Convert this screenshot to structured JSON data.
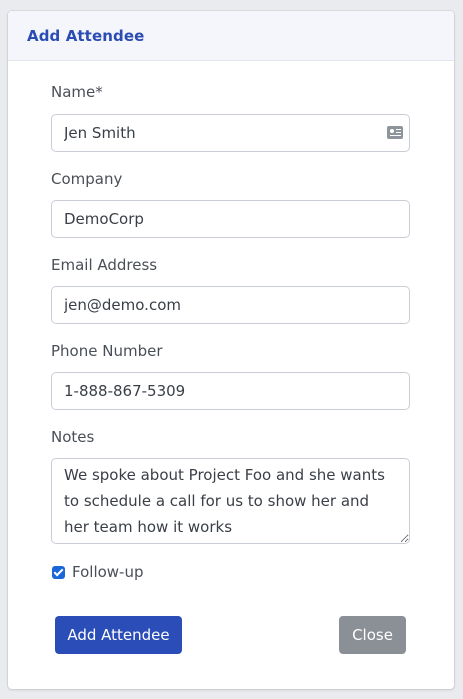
{
  "header": {
    "title": "Add Attendee"
  },
  "form": {
    "name": {
      "label": "Name*",
      "value": "Jen Smith",
      "icon": "contact-card-icon"
    },
    "company": {
      "label": "Company",
      "value": "DemoCorp"
    },
    "email": {
      "label": "Email Address",
      "value": "jen@demo.com"
    },
    "phone": {
      "label": "Phone Number",
      "value": "1-888-867-5309"
    },
    "notes": {
      "label": "Notes",
      "value": "We spoke about Project Foo and she wants to schedule a call for us to show her and her team how it works"
    },
    "followup": {
      "label": "Follow-up",
      "checked": true
    }
  },
  "actions": {
    "submit_label": "Add Attendee",
    "close_label": "Close"
  },
  "colors": {
    "accent": "#2a4db7",
    "title": "#2b4db3",
    "secondary_button": "#8b8f96",
    "checkbox": "#1b66d8"
  }
}
